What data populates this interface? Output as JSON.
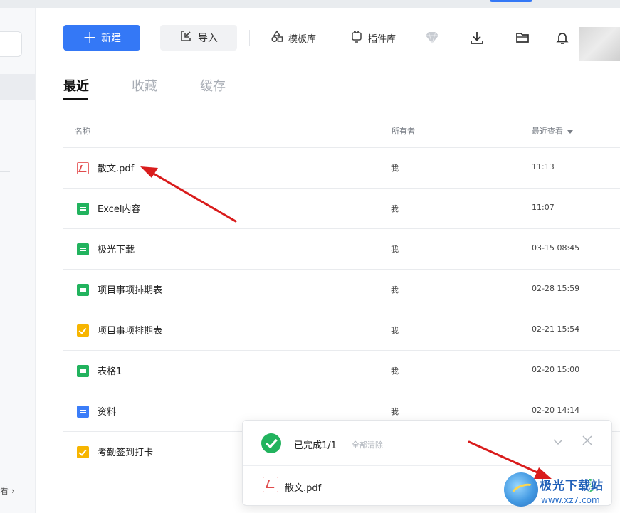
{
  "sidebar": {
    "more_label": "看 ›"
  },
  "toolbar": {
    "new_label": "新建",
    "import_label": "导入",
    "template_label": "模板库",
    "plugin_label": "插件库"
  },
  "tabs": [
    {
      "label": "最近",
      "active": true
    },
    {
      "label": "收藏",
      "active": false
    },
    {
      "label": "缓存",
      "active": false
    }
  ],
  "table": {
    "headers": {
      "name": "名称",
      "owner": "所有者",
      "recent": "最近查看"
    },
    "rows": [
      {
        "icon": "pdf-icon",
        "name": "散文.pdf",
        "owner": "我",
        "time": "11:13"
      },
      {
        "icon": "sheet-icon",
        "name": "Excel内容",
        "owner": "我",
        "time": "11:07"
      },
      {
        "icon": "sheet-icon",
        "name": "极光下载",
        "owner": "我",
        "time": "03-15 08:45"
      },
      {
        "icon": "sheet-icon",
        "name": "项目事项排期表",
        "owner": "我",
        "time": "02-28 15:59"
      },
      {
        "icon": "task-icon",
        "name": "项目事项排期表",
        "owner": "我",
        "time": "02-21 15:54"
      },
      {
        "icon": "sheet-icon",
        "name": "表格1",
        "owner": "我",
        "time": "02-20 15:00"
      },
      {
        "icon": "doc-icon",
        "name": "资料",
        "owner": "我",
        "time": "02-20 14:14"
      },
      {
        "icon": "task-icon",
        "name": "考勤签到打卡",
        "owner": "",
        "time": ""
      }
    ]
  },
  "download_panel": {
    "status": "已完成1/1",
    "clear_all": "全部清除",
    "file_name": "散文.pdf"
  },
  "watermark": {
    "title": "极光下载站",
    "url": "www.xz7.com"
  },
  "colors": {
    "accent": "#3478f6",
    "success": "#22b35e",
    "pdf": "#e04b4c",
    "annotation_arrow": "#d91c1c"
  }
}
